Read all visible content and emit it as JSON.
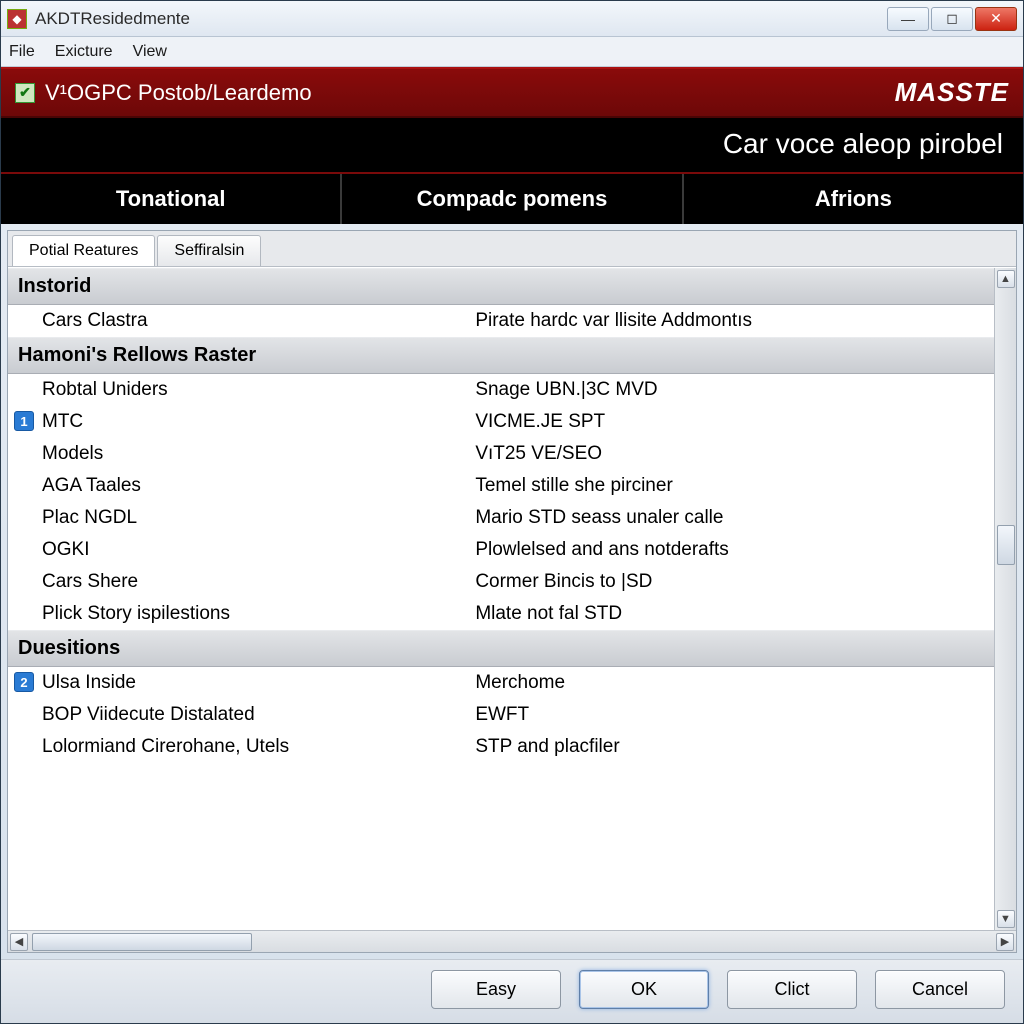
{
  "window": {
    "title": "AKDTResidedmente"
  },
  "menus": {
    "file": "File",
    "exicture": "Exicture",
    "view": "View"
  },
  "banner": {
    "headline": "V¹OGPC Postob/Leardemo",
    "brand": "MASSTE",
    "subtitle": "Car voce aleop pirobel",
    "nav": [
      "Tonational",
      "Compadc pomens",
      "Afrions"
    ]
  },
  "tabs": {
    "active": "Potial Reatures",
    "other": "Seffiralsin"
  },
  "sections": [
    {
      "title": "Instorid",
      "rows": [
        {
          "k": "Cars Clastra",
          "v": "Pirate hardc var llisite Addmontıs"
        }
      ]
    },
    {
      "title": "Hamoni's Rellows Raster",
      "rows": [
        {
          "k": "Robtal Uniders",
          "v": "Snage UBN.|3C MVD"
        },
        {
          "icon": "1",
          "k": "MTC",
          "v": "VICME.JE SPT"
        },
        {
          "k": "Models",
          "v": "VıT25 VE/SEO"
        },
        {
          "k": "AGA Taales",
          "v": "Temel stille she pirciner"
        },
        {
          "k": "Plac NGDL",
          "v": "Mario STD seass unaler calle"
        },
        {
          "k": "OGKI",
          "v": "Plowlelsed and ans notderafts"
        },
        {
          "k": "Cars Shere",
          "v": "Cormer Bincis to |SD"
        },
        {
          "k": "Plick Story ispilestions",
          "v": "Mlate not fal STD"
        }
      ]
    },
    {
      "title": "Duesitions",
      "rows": [
        {
          "icon": "2",
          "k": "Ulsa Inside",
          "v": "Merchome"
        },
        {
          "k": "BOP Viidecute Distalated",
          "v": "EWFT"
        },
        {
          "k": "Lolormiand Cirerohane, Utels",
          "v": "STP and placfiler"
        }
      ]
    }
  ],
  "buttons": {
    "easy": "Easy",
    "ok": "OK",
    "clict": "Clict",
    "cancel": "Cancel"
  }
}
